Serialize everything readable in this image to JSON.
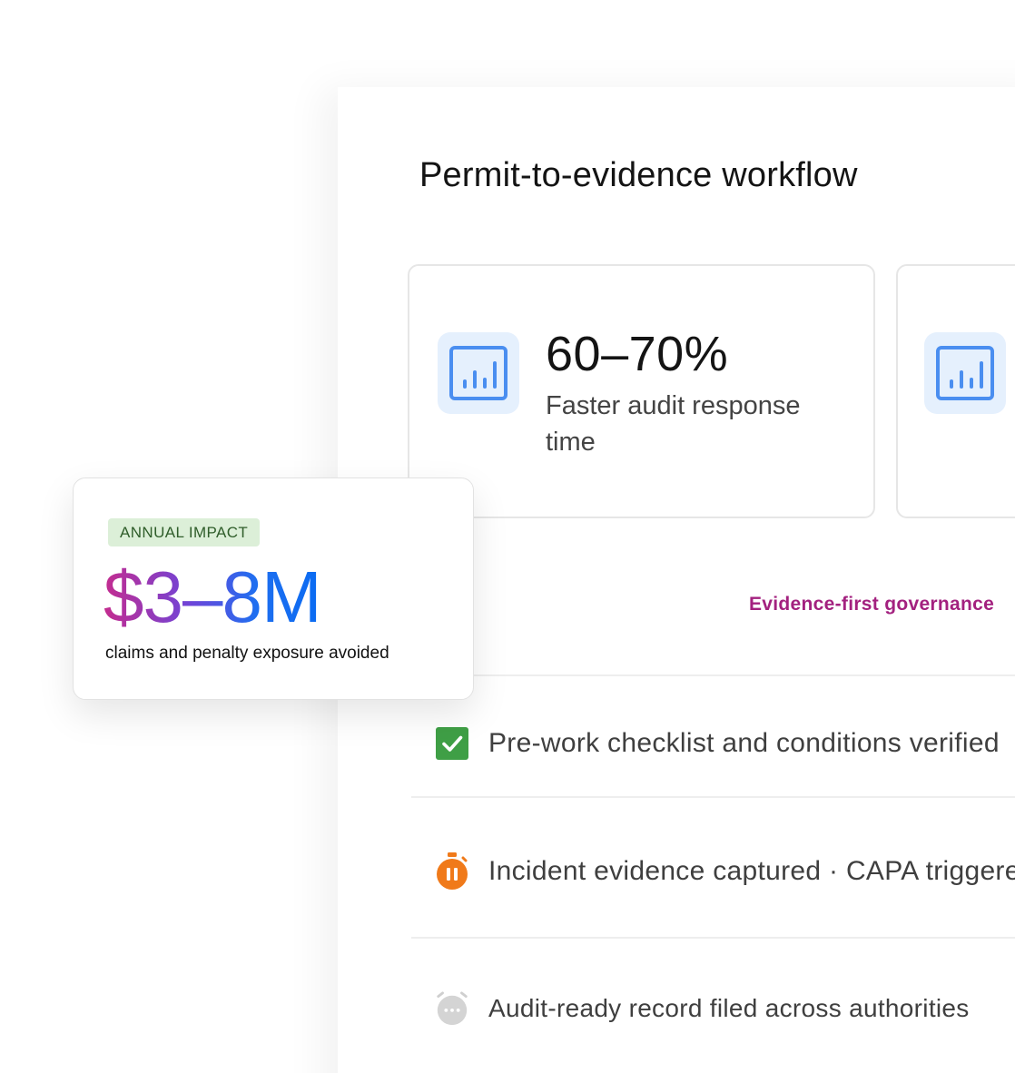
{
  "workflow": {
    "title": "Permit-to-evidence workflow",
    "accent_color": "#a3217f",
    "stats": [
      {
        "icon": "bar-chart-icon",
        "value": "60–70%",
        "label": "Faster audit response time"
      },
      {
        "icon": "bar-chart-icon"
      }
    ],
    "governance_label": "Evidence-first governance",
    "steps": [
      {
        "icon": "checkbox-checked-icon",
        "status_color": "#3f9f46",
        "label": "Pre-work checklist and conditions verified"
      },
      {
        "icon": "paused-timer-icon",
        "status_color": "#f07a1a",
        "label": "Incident evidence captured · CAPA triggered"
      },
      {
        "icon": "pending-timer-icon",
        "status_color": "#c8c8c8",
        "label": "Audit-ready record filed across authorities"
      }
    ]
  },
  "impact": {
    "badge": "ANNUAL IMPACT",
    "value": "$3–8M",
    "caption": "claims and penalty exposure avoided",
    "gradient_colors": [
      "#c42c8f",
      "#1f6ff0"
    ]
  }
}
